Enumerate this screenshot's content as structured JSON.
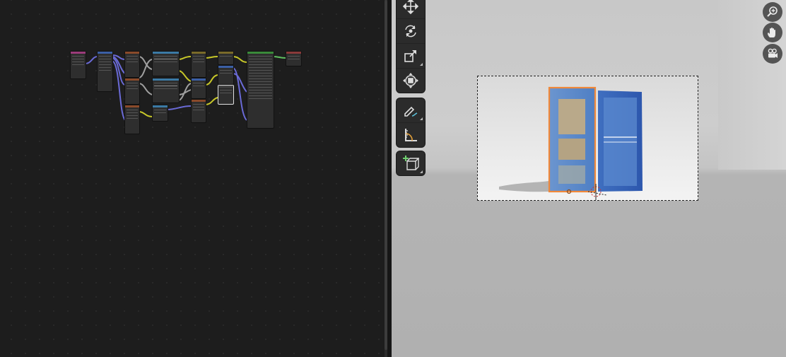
{
  "node_editor": {
    "nodes": [
      {
        "id": "n1",
        "color": "#9b3b7a"
      },
      {
        "id": "n2",
        "color": "#3b5fa5"
      },
      {
        "id": "n3",
        "color": "#8a4a2a"
      },
      {
        "id": "n4",
        "color": "#8a4a2a"
      },
      {
        "id": "n5",
        "color": "#8a4a2a"
      },
      {
        "id": "n6",
        "color": "#3b7aa5"
      },
      {
        "id": "n7",
        "color": "#3b7aa5"
      },
      {
        "id": "n8",
        "color": "#3b7aa5"
      },
      {
        "id": "n9",
        "color": "#7a6a2a"
      },
      {
        "id": "n10",
        "color": "#3b5fa5"
      },
      {
        "id": "n11",
        "color": "#8a4a2a"
      },
      {
        "id": "n12",
        "color": "#7a6a2a"
      },
      {
        "id": "n13",
        "color": "#3b5fa5"
      },
      {
        "id": "n14",
        "color": "#444444"
      },
      {
        "id": "n15",
        "color": "#3a8a3a"
      },
      {
        "id": "n16",
        "color": "#8a3a3a"
      }
    ],
    "link_colors": {
      "shader": "#5fbf5f",
      "vector": "#6a6ad6",
      "color": "#c7c729",
      "float": "#a0a0a0"
    }
  },
  "viewport": {
    "tools": [
      {
        "name": "move",
        "icon": "move-icon"
      },
      {
        "name": "rotate",
        "icon": "rotate-icon"
      },
      {
        "name": "scale",
        "icon": "scale-icon"
      },
      {
        "name": "transform",
        "icon": "transform-icon"
      },
      {
        "name": "annotate",
        "icon": "annotate-icon"
      },
      {
        "name": "measure",
        "icon": "measure-icon"
      },
      {
        "name": "add-cube",
        "icon": "add-cube-icon"
      }
    ],
    "navigation": [
      {
        "name": "zoom",
        "icon": "zoom-in-icon"
      },
      {
        "name": "pan",
        "icon": "hand-icon"
      },
      {
        "name": "camera-view",
        "icon": "camera-icon"
      }
    ],
    "object_colors": {
      "door": "#4f7fc4",
      "selection": "#f0883a",
      "panel": "#b9a98a"
    }
  }
}
